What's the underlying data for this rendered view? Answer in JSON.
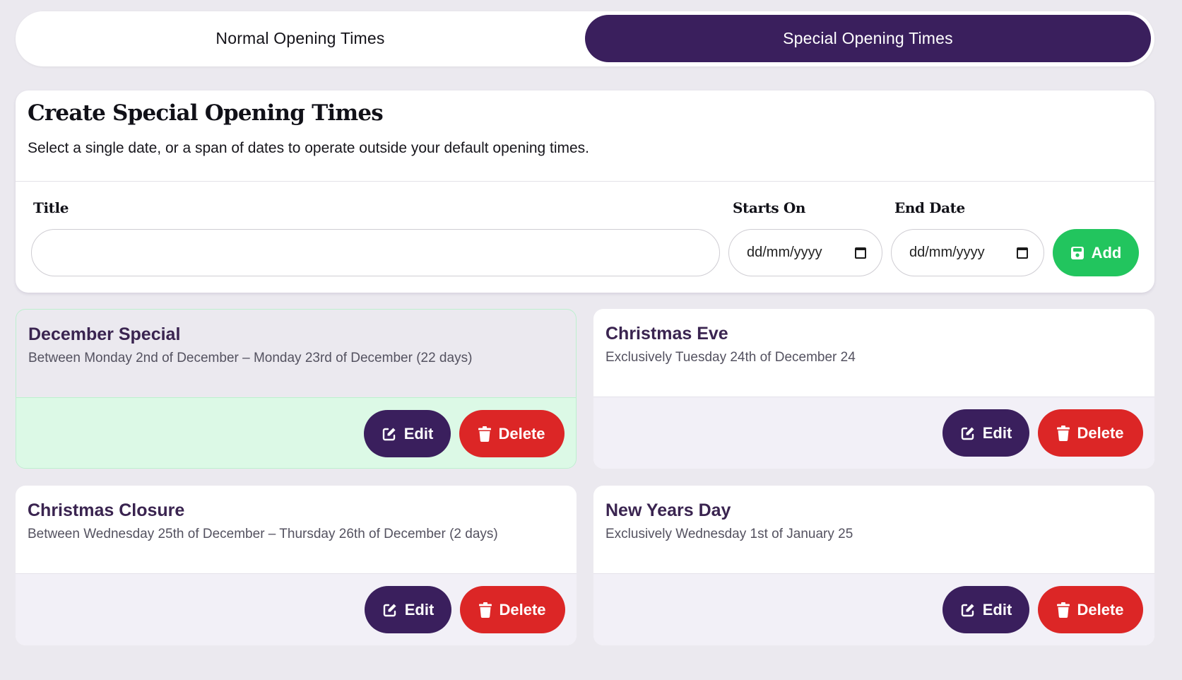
{
  "tabs": [
    {
      "label": "Normal Opening Times",
      "active": false
    },
    {
      "label": "Special Opening Times",
      "active": true
    }
  ],
  "create": {
    "title": "Create Special Opening Times",
    "description": "Select a single date, or a span of dates to operate outside your default opening times.",
    "fields": {
      "title_label": "Title",
      "title_value": "",
      "start_label": "Starts On",
      "start_placeholder": "dd/mm/yyyy",
      "end_label": "End Date",
      "end_placeholder": "dd/mm/yyyy"
    },
    "add_label": "Add"
  },
  "items": [
    {
      "title": "December Special",
      "subtitle": "Between Monday 2nd of December – Monday 23rd of December (22 days)",
      "highlighted": true
    },
    {
      "title": "Christmas Eve",
      "subtitle": "Exclusively Tuesday 24th of December 24",
      "highlighted": false
    },
    {
      "title": "Christmas Closure",
      "subtitle": "Between Wednesday 25th of December – Thursday 26th of December (2 days)",
      "highlighted": false
    },
    {
      "title": "New Years Day",
      "subtitle": "Exclusively Wednesday 1st of January 25",
      "highlighted": false
    }
  ],
  "actions": {
    "edit_label": "Edit",
    "delete_label": "Delete"
  },
  "colors": {
    "primary": "#3a1f5d",
    "success": "#22c55e",
    "danger": "#dc2626",
    "highlight": "#dcf9e6"
  }
}
